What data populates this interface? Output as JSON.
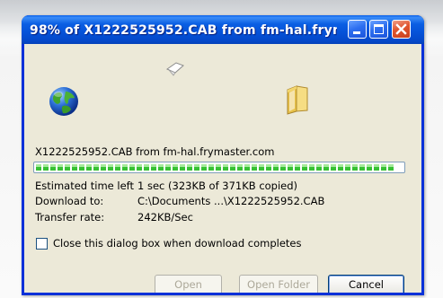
{
  "window": {
    "title": "98% of X1222525952.CAB from fm-hal.frym...",
    "progress_fraction": 0.98
  },
  "content": {
    "file_line": "X1222525952.CAB from fm-hal.frymaster.com",
    "estimated_label": "Estimated time left",
    "estimated_value": "1 sec (323KB of 371KB copied)",
    "download_to_label": "Download to:",
    "download_to_value": "C:\\Documents ...\\X1222525952.CAB",
    "transfer_rate_label": "Transfer rate:",
    "transfer_rate_value": "242KB/Sec",
    "close_checkbox_label": "Close this dialog box when download completes",
    "close_checkbox_checked": false
  },
  "buttons": {
    "open": "Open",
    "open_folder": "Open Folder",
    "cancel": "Cancel"
  },
  "icons": {
    "source": "globe-icon",
    "file": "flying-paper-icon",
    "destination": "folder-icon"
  }
}
